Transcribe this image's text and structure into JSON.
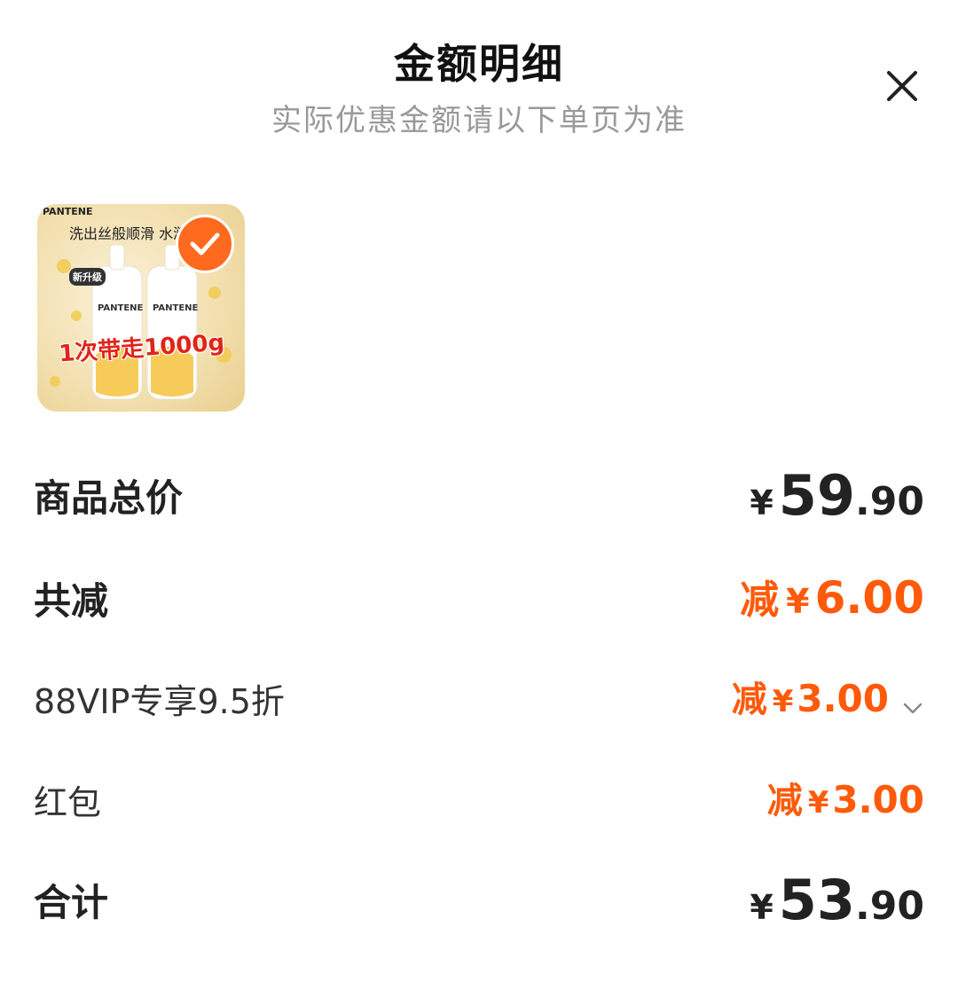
{
  "header": {
    "title": "金额明细",
    "subtitle": "实际优惠金额请以下单页为准",
    "close_icon": "close-icon"
  },
  "product": {
    "brand": "PANTENE",
    "tagline": "洗出丝般顺滑 水润",
    "promo": "1次带走1000g",
    "badge_new": "新升级",
    "selected_icon": "check-icon"
  },
  "rows": {
    "subtotal": {
      "label": "商品总价",
      "currency": "¥",
      "int": "59",
      "dec": ".90"
    },
    "total_discount": {
      "label": "共减",
      "prefix": "减",
      "currency": "¥",
      "amount": "6.00"
    },
    "vip": {
      "label": "88VIP专享9.5折",
      "prefix": "减",
      "currency": "¥",
      "amount": "3.00",
      "icon": "chevron-down-icon"
    },
    "redpacket": {
      "label": "红包",
      "prefix": "减",
      "currency": "¥",
      "amount": "3.00"
    },
    "total": {
      "label": "合计",
      "currency": "¥",
      "int": "53",
      "dec": ".90"
    }
  },
  "colors": {
    "accent": "#ff5a0a",
    "check_bg": "#ff6a1f"
  }
}
